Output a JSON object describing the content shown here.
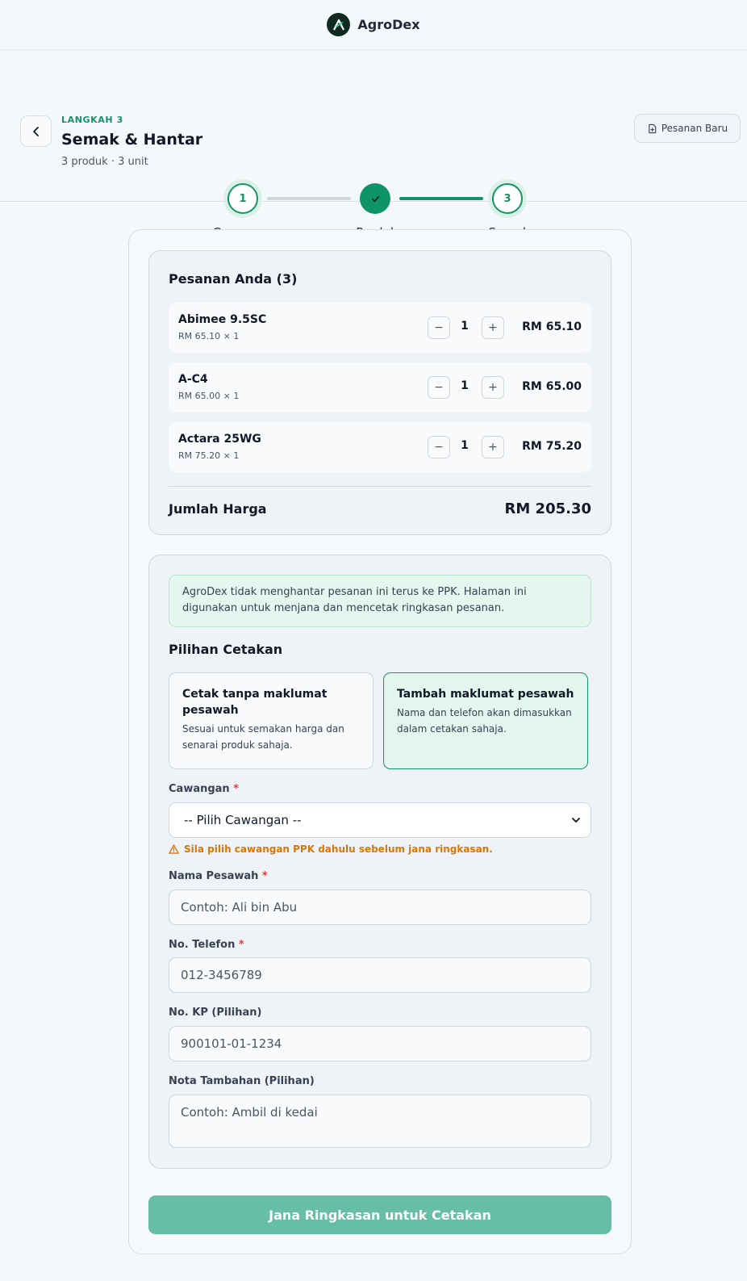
{
  "app": {
    "name": "AgroDex"
  },
  "header": {
    "step_kicker": "LANGKAH 3",
    "title": "Semak & Hantar",
    "subtitle": "3 produk · 3 unit",
    "new_order_label": "Pesanan Baru"
  },
  "stepper": {
    "steps": [
      {
        "label": "Cawangan",
        "number": "1",
        "state": "pending"
      },
      {
        "label": "Produk",
        "number": "2",
        "state": "done"
      },
      {
        "label": "Semak",
        "number": "3",
        "state": "current"
      }
    ]
  },
  "cart": {
    "title": "Pesanan Anda (3)",
    "items": [
      {
        "name": "Abimee 9.5SC",
        "unit_line": "RM 65.10 × 1",
        "qty": "1",
        "total": "RM 65.10"
      },
      {
        "name": "A-C4",
        "unit_line": "RM 65.00 × 1",
        "qty": "1",
        "total": "RM 65.00"
      },
      {
        "name": "Actara 25WG",
        "unit_line": "RM 75.20 × 1",
        "qty": "1",
        "total": "RM 75.20"
      }
    ],
    "total_label": "Jumlah Harga",
    "total_value": "RM 205.30"
  },
  "form": {
    "notice": "AgroDex tidak menghantar pesanan ini terus ke PPK. Halaman ini digunakan untuk menjana dan mencetak ringkasan pesanan.",
    "print_section_title": "Pilihan Cetakan",
    "print_options": [
      {
        "title": "Cetak tanpa maklumat pesawah",
        "desc": "Sesuai untuk semakan harga dan senarai produk sahaja.",
        "selected": false
      },
      {
        "title": "Tambah maklumat pesawah",
        "desc": "Nama dan telefon akan dimasukkan dalam cetakan sahaja.",
        "selected": true
      }
    ],
    "branch": {
      "label": "Cawangan",
      "required_mark": "*",
      "value": "-- Pilih Cawangan --",
      "warning": "Sila pilih cawangan PPK dahulu sebelum jana ringkasan."
    },
    "farmer_name": {
      "label": "Nama Pesawah",
      "required_mark": "*",
      "placeholder": "Contoh: Ali bin Abu"
    },
    "phone": {
      "label": "No. Telefon",
      "required_mark": "*",
      "placeholder": "012-3456789"
    },
    "ic": {
      "label": "No. KP (Pilihan)",
      "placeholder": "900101-01-1234"
    },
    "notes": {
      "label": "Nota Tambahan (Pilihan)",
      "placeholder": "Contoh: Ambil di kedai"
    }
  },
  "submit_label": "Jana Ringkasan untuk Cetakan",
  "colors": {
    "accent": "#149467",
    "submit_disabled": "#66bea5",
    "warning": "#d97706",
    "required": "#e23b3b"
  }
}
